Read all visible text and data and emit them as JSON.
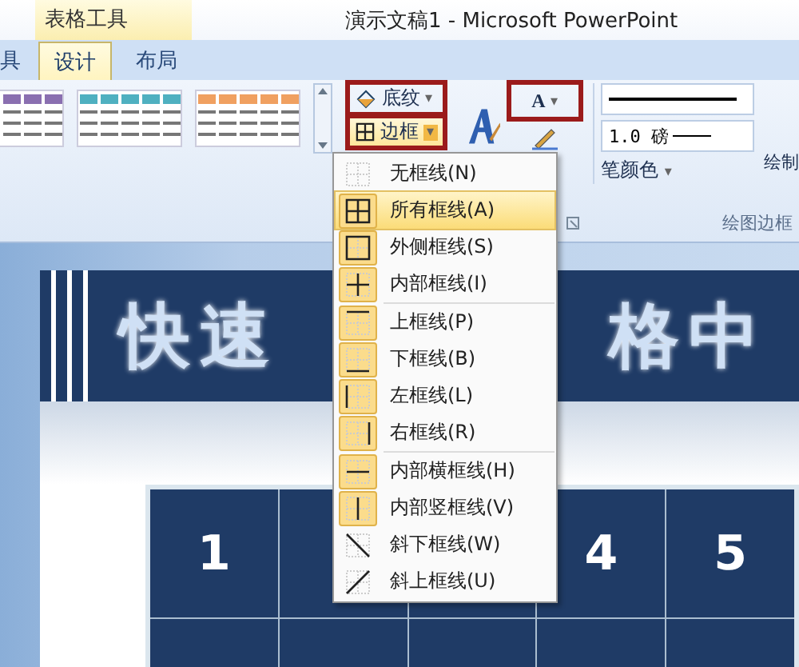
{
  "window": {
    "title": "演示文稿1 - Microsoft PowerPoint",
    "context_tab": "表格工具"
  },
  "tabs": [
    {
      "label": "具",
      "selected": false
    },
    {
      "label": "设计",
      "selected": true
    },
    {
      "label": "布局",
      "selected": false
    }
  ],
  "ribbon": {
    "styles": [
      {
        "color": "#8a6fb0"
      },
      {
        "color": "#4fb0c0"
      },
      {
        "color": "#f0a060"
      }
    ],
    "shading": {
      "label": "底纹",
      "icon": "▾"
    },
    "borders": {
      "label": "边框",
      "icon": "▾"
    },
    "text_fill": {
      "label": "A",
      "icon": "▾"
    },
    "line_weight": "1.0 磅",
    "pen_color": "笔颜色",
    "pen_color_icon": "▾",
    "draw": "绘制",
    "group_label": "绘图边框"
  },
  "menu": [
    {
      "label": "无框线(N)",
      "checked": false,
      "selected": false,
      "kind": "none"
    },
    {
      "label": "所有框线(A)",
      "checked": true,
      "selected": true,
      "kind": "all"
    },
    {
      "label": "外侧框线(S)",
      "checked": true,
      "selected": false,
      "kind": "outside"
    },
    {
      "label": "内部框线(I)",
      "checked": true,
      "selected": false,
      "kind": "inside"
    },
    {
      "label": "上框线(P)",
      "checked": true,
      "selected": false,
      "kind": "top",
      "separator": true
    },
    {
      "label": "下框线(B)",
      "checked": true,
      "selected": false,
      "kind": "bottom"
    },
    {
      "label": "左框线(L)",
      "checked": true,
      "selected": false,
      "kind": "left"
    },
    {
      "label": "右框线(R)",
      "checked": true,
      "selected": false,
      "kind": "right"
    },
    {
      "label": "内部横框线(H)",
      "checked": true,
      "selected": false,
      "kind": "inner_h",
      "separator": true
    },
    {
      "label": "内部竖框线(V)",
      "checked": true,
      "selected": false,
      "kind": "inner_v"
    },
    {
      "label": "斜下框线(W)",
      "checked": false,
      "selected": false,
      "kind": "diag_down"
    },
    {
      "label": "斜上框线(U)",
      "checked": false,
      "selected": false,
      "kind": "diag_up"
    }
  ],
  "slide": {
    "title_left": "快速",
    "title_right": "格中",
    "table": {
      "rows": [
        [
          "1",
          "",
          "",
          "4",
          "5"
        ],
        [
          "",
          "",
          "",
          "",
          ""
        ]
      ]
    }
  }
}
